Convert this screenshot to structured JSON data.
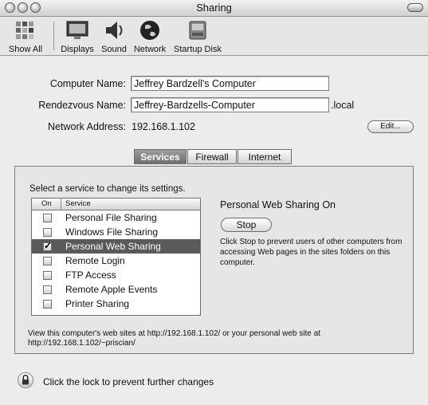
{
  "window": {
    "title": "Sharing"
  },
  "toolbar": {
    "items": [
      {
        "label": "Show All",
        "icon": "apple-icon"
      },
      {
        "label": "Displays",
        "icon": "display-icon"
      },
      {
        "label": "Sound",
        "icon": "speaker-icon"
      },
      {
        "label": "Network",
        "icon": "globe-icon"
      },
      {
        "label": "Startup Disk",
        "icon": "disk-icon"
      }
    ]
  },
  "identity": {
    "computer_name_label": "Computer Name:",
    "computer_name": "Jeffrey Bardzell's Computer",
    "rendezvous_label": "Rendezvous Name:",
    "rendezvous_name": "Jeffrey-Bardzells-Computer",
    "rendezvous_suffix": ".local",
    "network_address_label": "Network Address:",
    "network_address": "192.168.1.102",
    "edit_button": "Edit..."
  },
  "tabs": [
    "Services",
    "Firewall",
    "Internet"
  ],
  "services": {
    "instruction": "Select a service to change its settings.",
    "col_on": "On",
    "col_service": "Service",
    "items": [
      {
        "name": "Personal File Sharing",
        "on": false,
        "selected": false
      },
      {
        "name": "Windows File Sharing",
        "on": false,
        "selected": false
      },
      {
        "name": "Personal Web Sharing",
        "on": true,
        "selected": true
      },
      {
        "name": "Remote Login",
        "on": false,
        "selected": false
      },
      {
        "name": "FTP Access",
        "on": false,
        "selected": false
      },
      {
        "name": "Remote Apple Events",
        "on": false,
        "selected": false
      },
      {
        "name": "Printer Sharing",
        "on": false,
        "selected": false
      }
    ],
    "status": "Personal Web Sharing On",
    "stop_button": "Stop",
    "description": "Click Stop to prevent users of other computers from accessing Web pages in the sites folders on this computer.",
    "web_info": "View this computer's web sites at http://192.168.1.102/ or your personal web site at http://192.168.1.102/~priscian/"
  },
  "lock": {
    "text": "Click the lock to prevent further changes"
  }
}
